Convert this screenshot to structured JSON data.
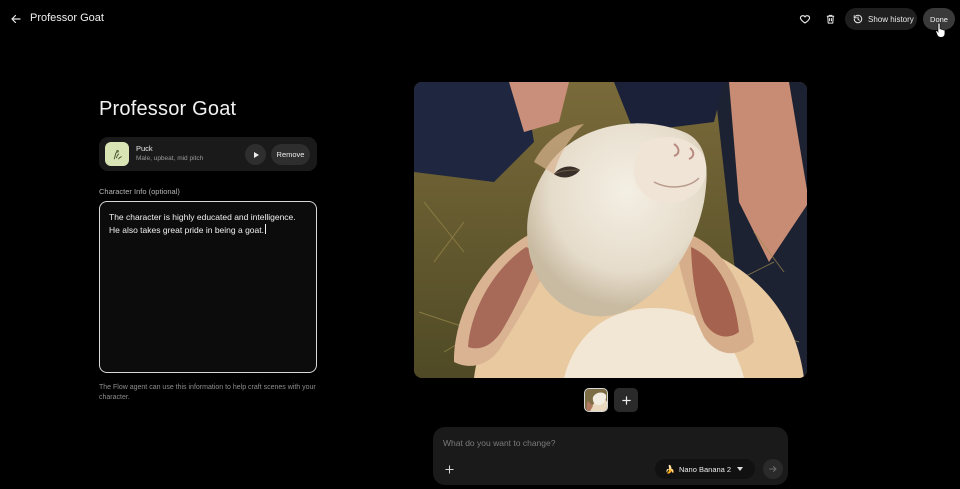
{
  "header": {
    "title": "Professor Goat",
    "show_history_label": "Show history",
    "done_label": "Done"
  },
  "character": {
    "name": "Professor Goat",
    "voice": {
      "name": "Puck",
      "description": "Male, upbeat, mid pitch",
      "remove_label": "Remove"
    },
    "info_label": "Character Info (optional)",
    "info_text": "The character is highly educated and intelligence.\nHe also takes great pride in being a goat.",
    "helper_text": "The Flow agent can use this information to help craft scenes with your character."
  },
  "prompt": {
    "placeholder": "What do you want to change?",
    "model": {
      "emoji": "🍌",
      "label": "Nano Banana 2"
    }
  },
  "icons": {
    "back": "arrow-left-icon",
    "favorite": "heart-icon",
    "delete": "trash-icon",
    "history": "history-icon",
    "play": "play-icon",
    "add": "plus-icon",
    "send": "arrow-right-icon",
    "dropdown": "caret-down-icon"
  },
  "colors": {
    "background": "#000000",
    "surface": "#1a1a1a",
    "voice_avatar": "#d9e4b5",
    "textarea_border": "#d8d8d8"
  }
}
